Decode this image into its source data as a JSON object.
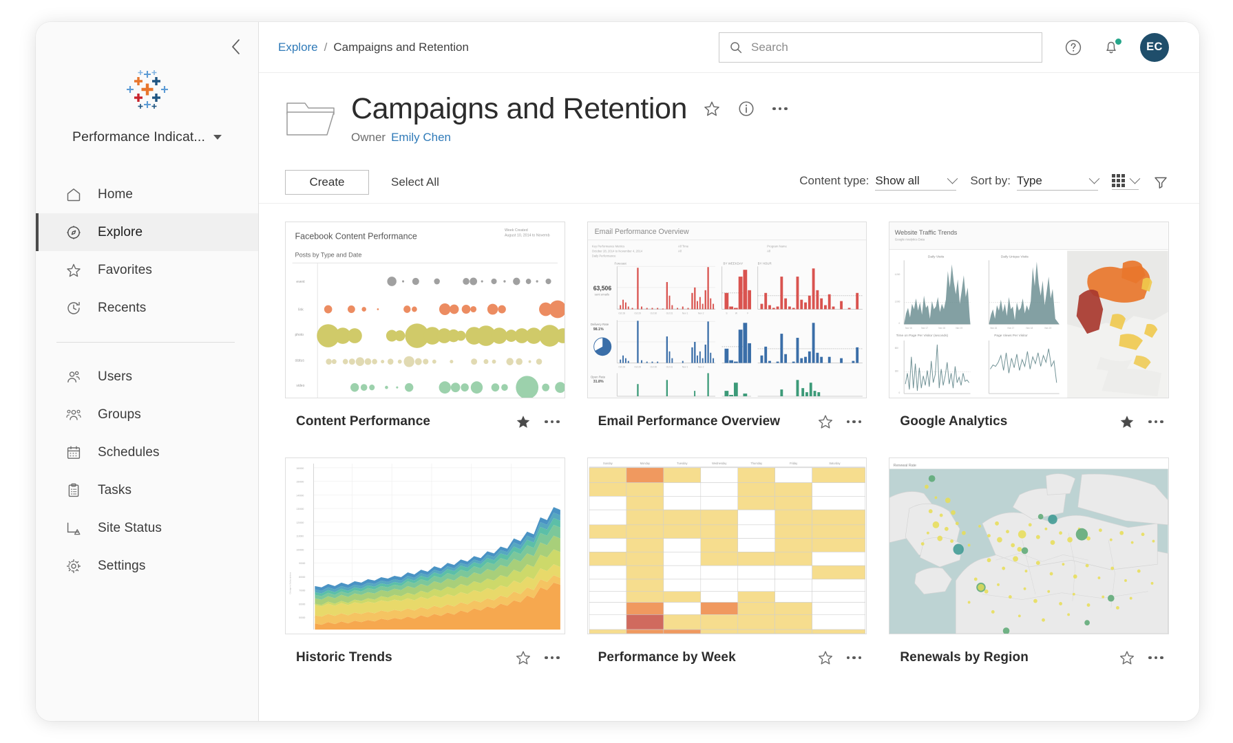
{
  "sidebar": {
    "collapse_icon": "chevron-left-icon",
    "logo_icon": "tableau-logo",
    "site_name": "Performance Indicat...",
    "site_caret_icon": "caret-down-icon",
    "nav_primary": [
      {
        "label": "Home",
        "icon": "home-icon",
        "active": false
      },
      {
        "label": "Explore",
        "icon": "compass-icon",
        "active": true
      },
      {
        "label": "Favorites",
        "icon": "star-icon",
        "active": false
      },
      {
        "label": "Recents",
        "icon": "clock-icon",
        "active": false
      }
    ],
    "nav_secondary": [
      {
        "label": "Users",
        "icon": "users-icon",
        "active": false
      },
      {
        "label": "Groups",
        "icon": "groups-icon",
        "active": false
      },
      {
        "label": "Schedules",
        "icon": "calendar-icon",
        "active": false
      },
      {
        "label": "Tasks",
        "icon": "clipboard-icon",
        "active": false
      },
      {
        "label": "Site Status",
        "icon": "site-status-icon",
        "active": false
      },
      {
        "label": "Settings",
        "icon": "gear-icon",
        "active": false
      }
    ]
  },
  "topbar": {
    "breadcrumb_root": "Explore",
    "breadcrumb_sep": "/",
    "breadcrumb_current": "Campaigns and Retention",
    "search_placeholder": "Search",
    "search_value": "",
    "search_icon": "search-icon",
    "help_icon": "help-circle-icon",
    "bell_icon": "bell-icon",
    "avatar_initials": "EC"
  },
  "page_header": {
    "folder_icon": "folder-icon",
    "title": "Campaigns and Retention",
    "star_icon": "star-outline-icon",
    "info_icon": "info-circle-icon",
    "more_icon": "ellipsis-icon",
    "owner_label": "Owner",
    "owner_name": "Emily Chen"
  },
  "toolbar": {
    "create_label": "Create",
    "select_all_label": "Select All",
    "content_type_label": "Content type:",
    "content_type_value": "Show all",
    "sort_by_label": "Sort by:",
    "sort_by_value": "Type",
    "grid_view_icon": "grid-view-icon",
    "filter_icon": "filter-funnel-icon"
  },
  "cards": [
    {
      "title": "Content Performance",
      "favorited": true,
      "thumb_type": "bubble",
      "thumb": {
        "title": "Facebook Content Performance",
        "subtitle": "Posts by Type and Date",
        "meta_line1": "Week Created",
        "meta_line2": "August 10, 2014 to Novemb",
        "row_labels": [
          "event",
          "link",
          "photo",
          "status",
          "video"
        ],
        "row_colors": [
          "#8c8c8c",
          "#e8703a",
          "#c3bc3f",
          "#ded5a8",
          "#87c79a"
        ]
      }
    },
    {
      "title": "Email Performance Overview",
      "favorited": false,
      "thumb_type": "email-dashboard",
      "thumb": {
        "title": "Email Performance Overview",
        "kpi_value": "63,506",
        "kpi_label": "sent emails",
        "panel_labels": [
          "Forecast",
          "By Weekday",
          "By Hour"
        ],
        "series_colors": [
          "#d9534f",
          "#3a6ea8",
          "#3c9a78"
        ],
        "row2_label": "Delivery Rate",
        "row2_value": "98.1%",
        "row3_label": "Open Rate",
        "row3_value": "31.8%"
      }
    },
    {
      "title": "Google Analytics",
      "favorited": true,
      "thumb_type": "traffic-dashboard",
      "thumb": {
        "title": "Website Traffic Trends",
        "subtitle": "Google Analytics Data",
        "panel1": "Daily Visits",
        "panel2": "Daily Unique Visits",
        "panel3": "Time on Page Per Visitor (seconds)",
        "panel4": "Page Views Per Visitor",
        "area_color": "#6d8f93",
        "map_colors": [
          "#e87e3c",
          "#a8382f",
          "#efc94c"
        ]
      }
    },
    {
      "title": "Historic Trends",
      "favorited": false,
      "thumb_type": "stacked-area",
      "thumb": {
        "band_colors": [
          "#f6a84f",
          "#f5c462",
          "#e8d96a",
          "#cdd96a",
          "#a8cf7a",
          "#7cc79a",
          "#5cbfa8",
          "#56a8c0",
          "#4a93c4"
        ]
      }
    },
    {
      "title": "Performance by Week",
      "favorited": false,
      "thumb_type": "calendar-heatmap",
      "thumb": {
        "columns": [
          "Sunday",
          "Monday",
          "Tuesday",
          "Wednesday",
          "Thursday",
          "Friday",
          "Saturday"
        ],
        "cell_colors": {
          "low": "#f6dd8e",
          "mid": "#f0995f",
          "high": "#d06a5e",
          "empty": "#ffffff"
        }
      }
    },
    {
      "title": "Renewals by Region",
      "favorited": false,
      "thumb_type": "symbol-map",
      "thumb": {
        "title": "Renewal Rate",
        "land_color": "#eaeaea",
        "water_color": "#bdd3d3",
        "dot_colors": [
          "#e8de55",
          "#5aa873",
          "#3f9a93"
        ]
      }
    }
  ]
}
